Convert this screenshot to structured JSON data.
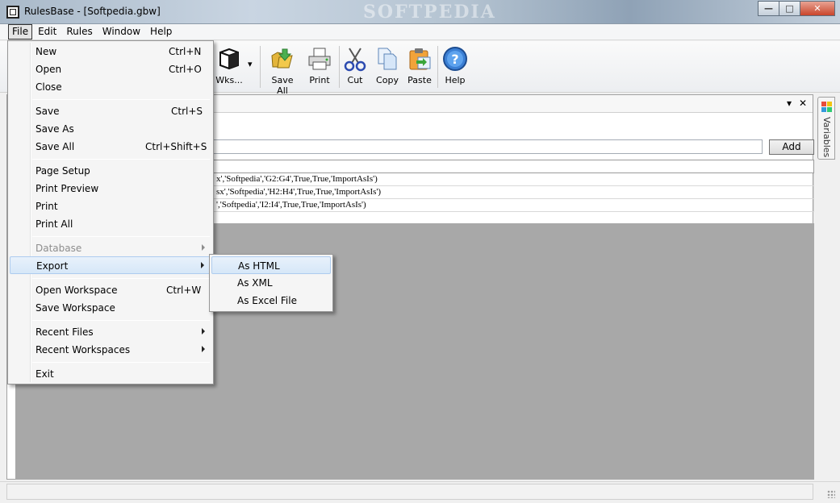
{
  "window": {
    "title": "RulesBase - [Softpedia.gbw]",
    "watermark": "SOFTPEDIA",
    "minimize": "—",
    "maximize": "□",
    "close": "✕"
  },
  "menubar": [
    "File",
    "Edit",
    "Rules",
    "Window",
    "Help"
  ],
  "toolbar": {
    "buttons": [
      {
        "label": "Wks...",
        "icon": "worksheet-icon"
      },
      {
        "label": "Save All",
        "icon": "save-all-icon"
      },
      {
        "label": "Print",
        "icon": "printer-icon"
      },
      {
        "label": "Cut",
        "icon": "scissors-icon"
      },
      {
        "label": "Copy",
        "icon": "copy-icon"
      },
      {
        "label": "Paste",
        "icon": "paste-icon"
      },
      {
        "label": "Help",
        "icon": "help-icon"
      }
    ],
    "dropdown_arrow": "▾"
  },
  "panel": {
    "dropdown_ctrl": "▾",
    "close_ctrl": "✕",
    "add_input_value": "",
    "add_button": "Add"
  },
  "grid": {
    "rows": [
      "x','Softpedia','G2:G4',True,True,'ImportAsIs')",
      "sx','Softpedia','H2:H4',True,True,'ImportAsIs')",
      "','Softpedia','I2:I4',True,True,'ImportAsIs')"
    ]
  },
  "side_tab": {
    "label": "Variables"
  },
  "file_menu": {
    "new": {
      "label": "New",
      "shortcut": "Ctrl+N"
    },
    "open": {
      "label": "Open",
      "shortcut": "Ctrl+O"
    },
    "close": {
      "label": "Close"
    },
    "save": {
      "label": "Save",
      "shortcut": "Ctrl+S"
    },
    "save_as": {
      "label": "Save As"
    },
    "save_all": {
      "label": "Save All",
      "shortcut": "Ctrl+Shift+S"
    },
    "page_setup": {
      "label": "Page Setup"
    },
    "print_preview": {
      "label": "Print Preview"
    },
    "print": {
      "label": "Print"
    },
    "print_all": {
      "label": "Print All"
    },
    "database": {
      "label": "Database"
    },
    "export": {
      "label": "Export"
    },
    "open_workspace": {
      "label": "Open Workspace",
      "shortcut": "Ctrl+W"
    },
    "save_workspace": {
      "label": "Save Workspace"
    },
    "recent_files": {
      "label": "Recent Files"
    },
    "recent_workspaces": {
      "label": "Recent Workspaces"
    },
    "exit": {
      "label": "Exit"
    }
  },
  "export_menu": {
    "as_html": "As HTML",
    "as_xml": "As XML",
    "as_excel": "As Excel File"
  }
}
